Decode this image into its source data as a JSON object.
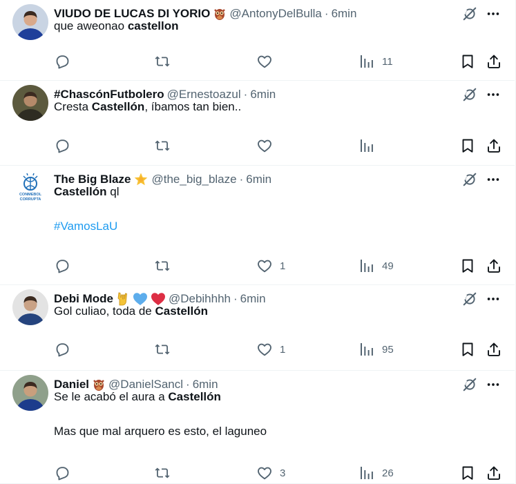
{
  "tweets": [
    {
      "display_name": "VIUDO DE LUCAS DI YORIO",
      "name_emojis": [
        "owl"
      ],
      "handle": "@AntonyDelBulla",
      "separator": "·",
      "time": "6min",
      "lines": [
        [
          {
            "t": "que aweonao "
          },
          {
            "t": "castellon",
            "b": true
          }
        ]
      ],
      "stats": {
        "replies": "",
        "reposts": "",
        "likes": "",
        "views": "11"
      },
      "avatar_colors": {
        "bg": "#c9d4e3",
        "shirt": "#1f3f9a",
        "skin": "#d9a98a"
      }
    },
    {
      "display_name": "#ChascónFutbolero",
      "name_emojis": [],
      "handle": "@Ernestoazul",
      "separator": "·",
      "time": "6min",
      "lines": [
        [
          {
            "t": "Cresta "
          },
          {
            "t": "Castellón",
            "b": true
          },
          {
            "t": ",  íbamos tan bien.."
          }
        ]
      ],
      "stats": {
        "replies": "",
        "reposts": "",
        "likes": "",
        "views": ""
      },
      "avatar_colors": {
        "bg": "#5c5a3e",
        "shirt": "#2e2c22",
        "skin": "#b58a6a"
      }
    },
    {
      "display_name": "The Big Blaze",
      "name_emojis": [
        "star"
      ],
      "handle": "@the_big_blaze",
      "separator": "·",
      "time": "6min",
      "lines": [
        [
          {
            "t": "Castellón",
            "b": true
          },
          {
            "t": " ql"
          }
        ],
        [],
        [
          {
            "t": "#VamosLaU",
            "h": true
          }
        ]
      ],
      "stats": {
        "replies": "",
        "reposts": "",
        "likes": "1",
        "views": "49"
      },
      "avatar_logo_text": [
        "CONMEBOL",
        "CORRUPTA"
      ],
      "avatar_colors": {
        "bg": "#ffffff",
        "logo": "#1f6fb8"
      }
    },
    {
      "display_name": "Debi Mode",
      "name_emojis": [
        "rock-hand",
        "blue-heart",
        "red-heart"
      ],
      "handle": "@Debihhhh",
      "separator": "·",
      "time": "6min",
      "lines": [
        [
          {
            "t": "Gol culiao, toda de "
          },
          {
            "t": "Castellón",
            "b": true
          }
        ]
      ],
      "stats": {
        "replies": "",
        "reposts": "",
        "likes": "1",
        "views": "95"
      },
      "avatar_colors": {
        "bg": "#e3e3e3",
        "shirt": "#25447e",
        "skin": "#c9a286"
      }
    },
    {
      "display_name": "Daniel",
      "name_emojis": [
        "owl"
      ],
      "handle": "@DanielSancl",
      "separator": "·",
      "time": "6min",
      "lines": [
        [
          {
            "t": "Se le acabó el aura a "
          },
          {
            "t": "Castellón",
            "b": true
          }
        ],
        [],
        [
          {
            "t": "Mas que mal arquero es esto, el laguneo"
          }
        ]
      ],
      "stats": {
        "replies": "",
        "reposts": "",
        "likes": "3",
        "views": "26"
      },
      "avatar_colors": {
        "bg": "#8fa08b",
        "shirt": "#1c3c8c",
        "skin": "#c99f7d"
      }
    }
  ],
  "icons": {
    "reply": "reply-icon",
    "repost": "repost-icon",
    "like": "heart-icon",
    "views": "views-icon",
    "bookmark": "bookmark-icon",
    "share": "share-icon",
    "grok": "grok-icon",
    "more": "more-icon"
  },
  "colors": {
    "text": "#0f1419",
    "muted": "#536471",
    "link": "#1d9bf0",
    "border": "#eff3f4"
  }
}
